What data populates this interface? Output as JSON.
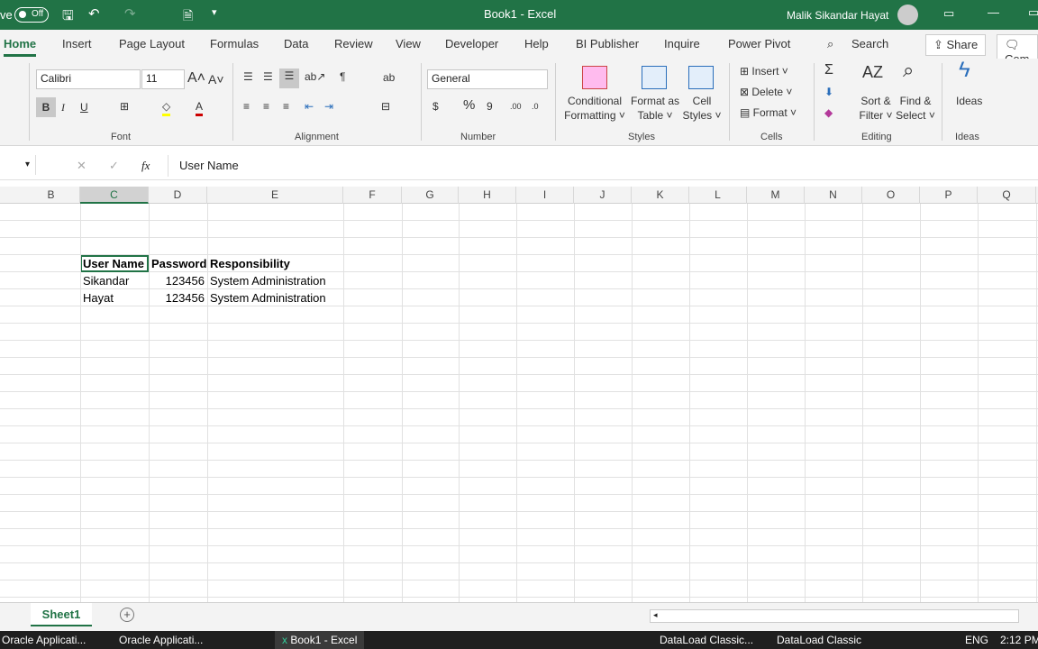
{
  "titlebar": {
    "autosave_label": "ve",
    "toggle": "Off",
    "title": "Book1  -  Excel",
    "user": "Malik Sikandar Hayat"
  },
  "tabs": [
    "Home",
    "Insert",
    "Page Layout",
    "Formulas",
    "Data",
    "Review",
    "View",
    "Developer",
    "Help",
    "BI Publisher",
    "Inquire",
    "Power Pivot"
  ],
  "search": "Search",
  "share": "Share",
  "comments": "Com",
  "ribbon": {
    "font_name": "Calibri",
    "font_size": "11",
    "number_format": "General",
    "groups": {
      "font": "Font",
      "alignment": "Alignment",
      "number": "Number",
      "styles": "Styles",
      "cells": "Cells",
      "editing": "Editing",
      "ideas": "Ideas"
    },
    "styles": {
      "conditional": [
        "Conditional",
        "Formatting"
      ],
      "format_table": [
        "Format as",
        "Table"
      ],
      "cell_styles": [
        "Cell",
        "Styles"
      ]
    },
    "cells": {
      "insert": "Insert",
      "delete": "Delete",
      "format": "Format"
    },
    "editing": {
      "sort": [
        "Sort &",
        "Filter"
      ],
      "find": [
        "Find &",
        "Select"
      ]
    },
    "ideas": "Ideas"
  },
  "formula_bar": {
    "content": "User Name",
    "fx": "fx"
  },
  "columns": [
    "B",
    "C",
    "D",
    "E",
    "F",
    "G",
    "H",
    "I",
    "J",
    "K",
    "L",
    "M",
    "N",
    "O",
    "P",
    "Q"
  ],
  "selected_column": "C",
  "table": {
    "headers": [
      "User Name",
      "Password",
      "Responsibility"
    ],
    "rows": [
      [
        "Sikandar",
        "123456",
        "System Administration"
      ],
      [
        "Hayat",
        "123456",
        "System Administration"
      ]
    ]
  },
  "sheet_tab": "Sheet1",
  "taskbar": {
    "items": [
      "Oracle Applicati...",
      "Oracle Applicati...",
      "Book1 - Excel",
      "DataLoad Classic...",
      "DataLoad Classic"
    ],
    "lang": "ENG",
    "time": "2:12 PM"
  }
}
